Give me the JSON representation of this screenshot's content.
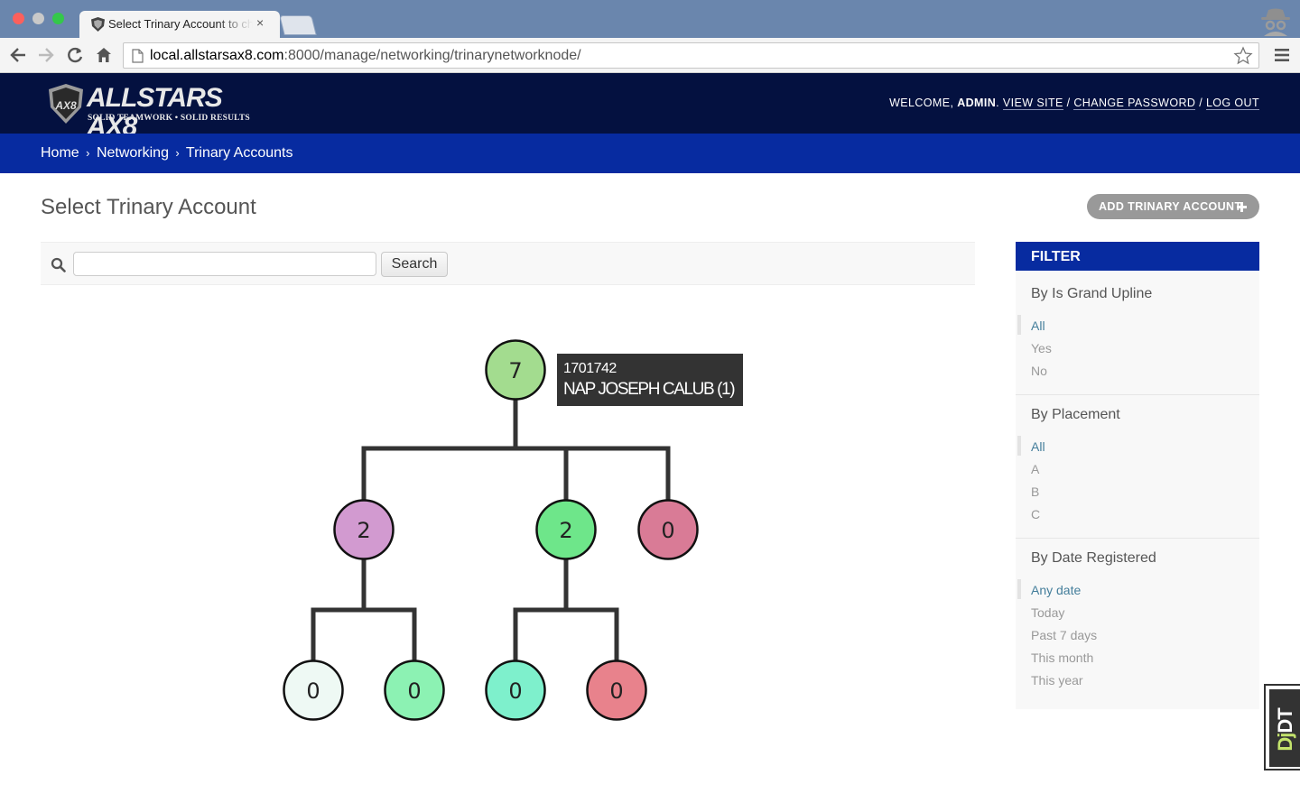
{
  "browser": {
    "tab_title": "Select Trinary Account to change",
    "tab_close": "×",
    "url_host": "local.allstarsax8.com",
    "url_rest": ":8000/manage/networking/trinarynetworknode/"
  },
  "site": {
    "logo_text": "ALLSTARS AX8",
    "tagline": "SOLID TEAMWORK • SOLID RESULTS",
    "welcome": "WELCOME,",
    "user": "ADMIN",
    "view_site": "VIEW SITE",
    "change_password": "CHANGE PASSWORD",
    "log_out": "LOG OUT",
    "slash": "/",
    "period": "."
  },
  "breadcrumbs": {
    "home": "Home",
    "networking": "Networking",
    "current": "Trinary Accounts",
    "sep": "›"
  },
  "page": {
    "title": "Select Trinary Account",
    "add_button": "ADD TRINARY ACCOUNT",
    "search_button": "Search",
    "search_value": ""
  },
  "tree": {
    "tooltip_id": "1701742",
    "tooltip_name": "NAP JOSEPH CALUB (1)",
    "nodes": [
      {
        "id": "root",
        "label": "7",
        "color": "#a3dc8f"
      },
      {
        "id": "a",
        "label": "2",
        "color": "#d29ad0"
      },
      {
        "id": "b",
        "label": "2",
        "color": "#6ee68a"
      },
      {
        "id": "c",
        "label": "0",
        "color": "#d97b96"
      },
      {
        "id": "aa",
        "label": "0",
        "color": "#eef9f4"
      },
      {
        "id": "ab",
        "label": "0",
        "color": "#8cf2b3"
      },
      {
        "id": "ba",
        "label": "0",
        "color": "#7ef0cc"
      },
      {
        "id": "bb",
        "label": "0",
        "color": "#e8828c"
      }
    ]
  },
  "filter": {
    "title": "FILTER",
    "groups": [
      {
        "title": "By Is Grand Upline",
        "options": [
          "All",
          "Yes",
          "No"
        ],
        "selected": 0
      },
      {
        "title": "By Placement",
        "options": [
          "All",
          "A",
          "B",
          "C"
        ],
        "selected": 0
      },
      {
        "title": "By Date Registered",
        "options": [
          "Any date",
          "Today",
          "Past 7 days",
          "This month",
          "This year"
        ],
        "selected": 0
      }
    ]
  },
  "debug_toolbar": {
    "d": "Dj",
    "rest": "DT"
  }
}
